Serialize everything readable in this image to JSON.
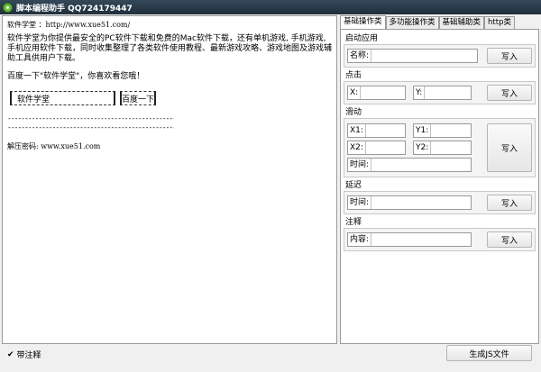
{
  "window": {
    "title": "脚本编程助手  QQ724179447"
  },
  "editor": {
    "line1": "软件学堂 ：http://www.xue51.com/",
    "para": "软件学堂为你提供最安全的PC软件下载和免费的Mac软件下载，还有单机游戏, 手机游戏, 手机应用软件下载，同时收集整理了各类软件使用教程、最新游戏攻略、游戏地图及游戏辅助工具供用户下载。",
    "baidu_line": "百度一下\"软件学堂\"，你喜欢看您哦！",
    "input_value": "软件学堂",
    "search_button": "百度一下",
    "dash1": "------------------------------------------------------------",
    "dash2": "------------------------------------------------------------",
    "password_line": "解压密码: www.xue51.com"
  },
  "tabs": [
    "基础操作类",
    "多功能操作类",
    "基础辅助类",
    "http类"
  ],
  "groups": {
    "launch": {
      "title": "启动应用",
      "name_label": "名称:",
      "write": "写入"
    },
    "click": {
      "title": "点击",
      "x_label": "X:",
      "y_label": "Y:",
      "write": "写入"
    },
    "swipe": {
      "title": "滑动",
      "x1_label": "X1:",
      "y1_label": "Y1:",
      "x2_label": "X2:",
      "y2_label": "Y2:",
      "time_label": "时间:",
      "write": "写入"
    },
    "delay": {
      "title": "延迟",
      "time_label": "时间:",
      "write": "写入"
    },
    "comment": {
      "title": "注释",
      "content_label": "内容:",
      "write": "写入"
    }
  },
  "footer": {
    "with_comment": "带注释",
    "generate_button": "生成JS文件"
  }
}
